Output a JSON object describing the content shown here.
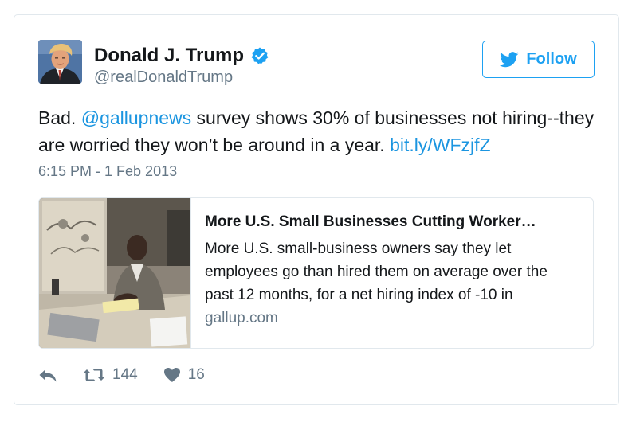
{
  "tweet": {
    "display_name": "Donald J. Trump",
    "handle": "@realDonaldTrump",
    "follow_label": "Follow",
    "text_pre": "Bad. ",
    "mention": "@gallupnews",
    "text_mid": " survey shows 30% of businesses not hiring--they are worried they won’t be around in a year. ",
    "url": "bit.ly/WFzjfZ",
    "timestamp": "6:15 PM - 1 Feb 2013",
    "retweets": "144",
    "likes": "16"
  },
  "card": {
    "title": "More U.S. Small Businesses Cutting Worker…",
    "description": "More U.S. small-business owners say they let employees go than hired them on average over the past 12 months, for a net hiring index of -10 in",
    "domain": "gallup.com"
  },
  "colors": {
    "accent": "#1da1f2",
    "link": "#1b95e0",
    "muted": "#657786",
    "text": "#14171a",
    "border": "#e1e8ed"
  },
  "icons": {
    "verified": "verified-badge-icon",
    "follow": "twitter-bird-icon",
    "reply": "reply-icon",
    "retweet": "retweet-icon",
    "like": "heart-icon"
  }
}
